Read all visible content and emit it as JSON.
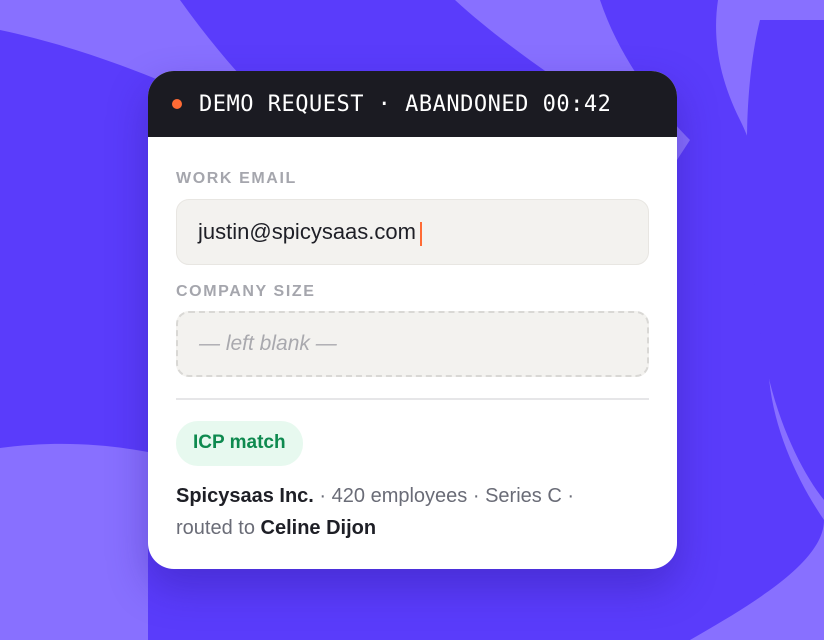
{
  "colors": {
    "background": "#5a3cfb",
    "wave": "#8870ff",
    "card_header": "#1b1b22",
    "status_dot": "#ff6b35",
    "badge_text": "#0e8a4f",
    "badge_bg": "#e7f9ef"
  },
  "header": {
    "status_icon": "status-dot",
    "title": "DEMO REQUEST · ABANDONED 00:42"
  },
  "form": {
    "email_label": "WORK EMAIL",
    "email_value": "justin@spicysaas.com",
    "size_label": "COMPANY SIZE",
    "size_placeholder": "— left blank —"
  },
  "enrichment": {
    "badge": "ICP match",
    "company": "Spicysaas Inc.",
    "details": " · 420 employees · Series C · ",
    "routed_prefix": "routed to ",
    "owner": "Celine Dijon"
  }
}
